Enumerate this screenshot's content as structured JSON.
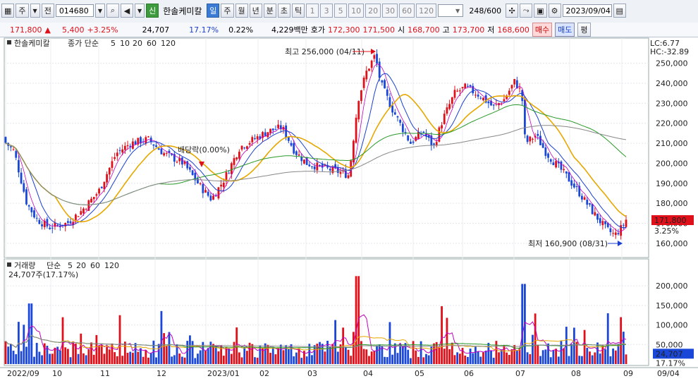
{
  "toolbar": {
    "code_icon": "grid-icon",
    "market_btn": "주",
    "all_btn": "전",
    "stock_code": "014680",
    "search_icon": "search-icon",
    "sound_icon": "speaker-icon",
    "badge_new": "신",
    "stock_name": "한솔케미칼",
    "period_buttons": [
      "일",
      "주",
      "월",
      "년",
      "분",
      "초",
      "틱"
    ],
    "active_period": "일",
    "interval_buttons": [
      "1",
      "3",
      "5",
      "10",
      "20",
      "30",
      "60",
      "120"
    ],
    "count_value": "248",
    "count_total": "/600",
    "date_value": "2023/09/04"
  },
  "quote": {
    "price": "171,800",
    "arrow": "▲",
    "change": "5,400",
    "change_pct": "+3.25%",
    "volume": "24,707",
    "turnover_pct": "17.17%",
    "ratio": "0.22%",
    "amount": "4,229백만",
    "label_hoga": "호가",
    "ask": "172,300",
    "bid": "171,500",
    "label_open": "시",
    "open": "168,700",
    "label_high": "고",
    "high": "173,700",
    "label_low": "저",
    "low": "168,600",
    "buy_btn": "매수",
    "sell_btn": "매도",
    "eval_btn": "평"
  },
  "price_panel": {
    "name": "한솔케미칼",
    "legend_prefix": "종가 단순",
    "ma": [
      "5",
      "10",
      "20",
      "60",
      "120"
    ],
    "lc": "LC:6.77",
    "hc": "HC:-32.89",
    "high_label": "최고 256,000 (04/11)",
    "low_label": "최저 160,900 (08/31)",
    "event_label": "배당락(0.00%)",
    "last_price": "171,800",
    "last_pct": "3.25%"
  },
  "volume_panel": {
    "name": "거래량",
    "legend_prefix": "단순",
    "ma": [
      "5",
      "20",
      "60",
      "120"
    ],
    "sub": "24,707주(17.17%)",
    "last_vol": "24,707",
    "last_pct": "17.17%"
  },
  "colors": {
    "up": "#e0101a",
    "down": "#1a47d8",
    "ma5": "#c000c0",
    "ma10": "#1a3fd0",
    "ma20": "#e6a800",
    "ma60": "#2a9a2a",
    "ma120": "#888888"
  },
  "chart_data": [
    {
      "type": "candlestick",
      "title": "한솔케미칼",
      "y_ticks": [
        "160,000",
        "170,000",
        "180,000",
        "190,000",
        "200,000",
        "210,000",
        "220,000",
        "230,000",
        "240,000",
        "250,000"
      ],
      "x_ticks": [
        "2022/09",
        "10",
        "11",
        "12",
        "2023/01",
        "02",
        "03",
        "04",
        "05",
        "06",
        "07",
        "08",
        "09",
        "09/04"
      ],
      "close_path_approx": [
        [
          "2022/09",
          213000
        ],
        [
          "2022/10",
          172000
        ],
        [
          "2022/10 mid",
          168000
        ],
        [
          "2022/11",
          186000
        ],
        [
          "2022/11 mid",
          210000
        ],
        [
          "2022/12",
          205000
        ],
        [
          "2022/12 late",
          185000
        ],
        [
          "2023/01",
          195000
        ],
        [
          "2023/01 mid",
          210000
        ],
        [
          "2023/02",
          208000
        ],
        [
          "2023/02 mid",
          221000
        ],
        [
          "2023/03",
          200000
        ],
        [
          "2023/03 late",
          193000
        ],
        [
          "2023/04",
          243000
        ],
        [
          "2023/04/11",
          256000
        ],
        [
          "2023/05",
          211000
        ],
        [
          "2023/05 mid",
          207000
        ],
        [
          "2023/06",
          236000
        ],
        [
          "2023/06 mid",
          231000
        ],
        [
          "2023/07",
          243000
        ],
        [
          "2023/07 mid",
          200000
        ],
        [
          "2023/08",
          211000
        ],
        [
          "2023/08/31",
          160900
        ],
        [
          "2023/09/04",
          171800
        ]
      ],
      "ylim": [
        155000,
        258000
      ]
    },
    {
      "type": "bar",
      "title": "거래량",
      "y_ticks": [
        "50,000",
        "100,000",
        "150,000",
        "200,000"
      ],
      "last_value": 24707,
      "ylim": [
        0,
        240000
      ]
    }
  ]
}
